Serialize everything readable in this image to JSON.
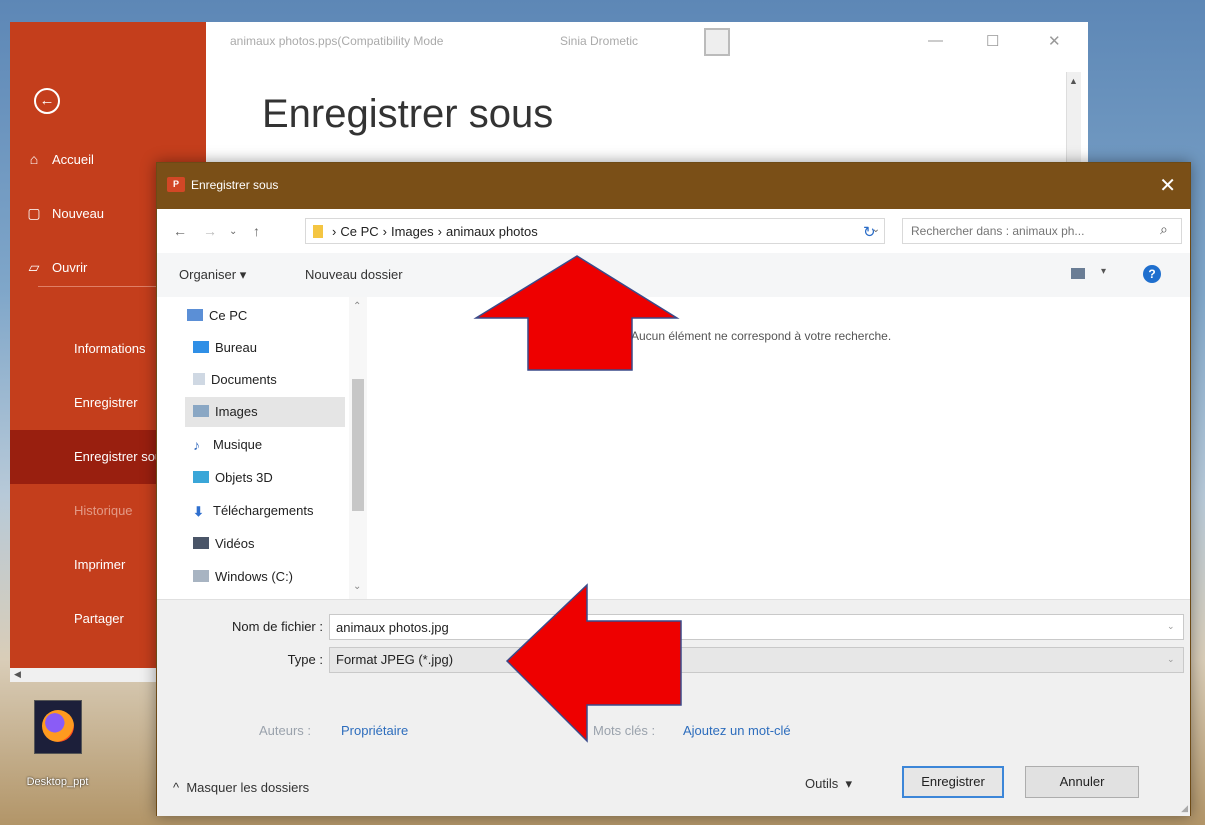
{
  "desktop": {
    "shortcut_label": "Desktop_ppt"
  },
  "powerpoint": {
    "title": "animaux photos.pps(Compatibility Mode",
    "user": "Sinia Drometic",
    "heading": "Enregistrer sous",
    "nav": [
      {
        "label": "Accueil",
        "icon": "home-icon"
      },
      {
        "label": "Nouveau",
        "icon": "new-file-icon"
      },
      {
        "label": "Ouvrir",
        "icon": "folder-open-icon"
      },
      {
        "label": "Informations"
      },
      {
        "label": "Enregistrer"
      },
      {
        "label": "Enregistrer sous"
      },
      {
        "label": "Historique"
      },
      {
        "label": "Imprimer"
      },
      {
        "label": "Partager"
      }
    ]
  },
  "dialog": {
    "title": "Enregistrer sous",
    "breadcrumb": [
      "Ce PC",
      "Images",
      "animaux photos"
    ],
    "search_placeholder": "Rechercher dans : animaux ph...",
    "toolbar": {
      "organize": "Organiser ▾",
      "new_folder": "Nouveau dossier"
    },
    "tree": [
      {
        "label": "Ce PC"
      },
      {
        "label": "Bureau"
      },
      {
        "label": "Documents"
      },
      {
        "label": "Images"
      },
      {
        "label": "Musique"
      },
      {
        "label": "Objets 3D"
      },
      {
        "label": "Téléchargements"
      },
      {
        "label": "Vidéos"
      },
      {
        "label": "Windows (C:)"
      }
    ],
    "empty_message": "Aucun élément ne correspond à votre recherche.",
    "filename_label": "Nom de fichier :",
    "filename_value": "animaux photos.jpg",
    "type_label": "Type :",
    "type_value": "Format JPEG (*.jpg)",
    "authors_label": "Auteurs :",
    "authors_value": "Propriétaire",
    "tags_label": "Mots clés :",
    "tags_value": "Ajoutez un mot-clé",
    "hide_folders": "Masquer les dossiers",
    "tools": "Outils",
    "save_button": "Enregistrer",
    "cancel_button": "Annuler"
  },
  "colors": {
    "pp_red": "#c43e1c",
    "pp_red_active": "#991f0f",
    "dialog_title": "#7a4f17",
    "arrow": "#ee0000",
    "link": "#2d6dbd"
  }
}
